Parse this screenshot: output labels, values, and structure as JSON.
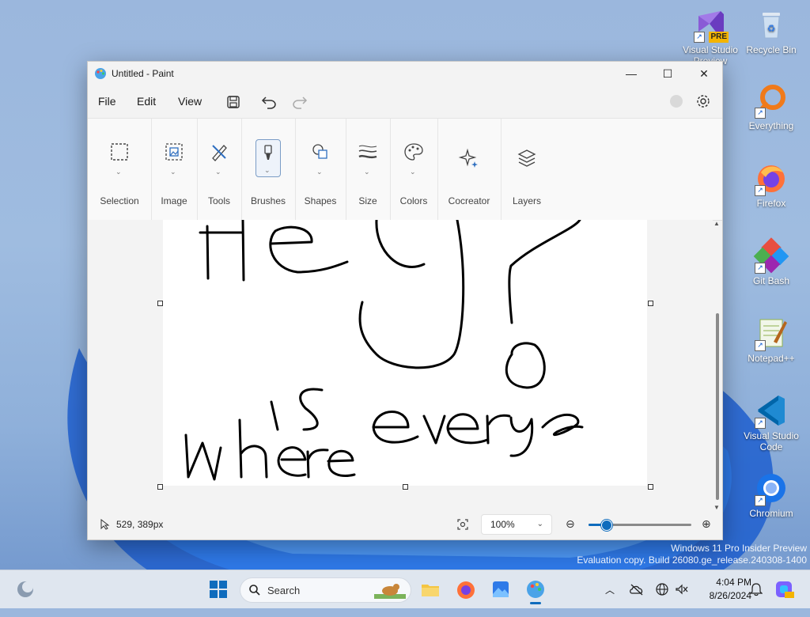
{
  "window": {
    "title": "Untitled - Paint",
    "minimize": "—",
    "maximize": "☐",
    "close": "✕"
  },
  "menu": {
    "file": "File",
    "edit": "Edit",
    "view": "View"
  },
  "ribbon": {
    "groups": [
      {
        "label": "Selection",
        "icon": "selection-icon"
      },
      {
        "label": "Image",
        "icon": "image-icon"
      },
      {
        "label": "Tools",
        "icon": "tools-icon"
      },
      {
        "label": "Brushes",
        "icon": "brush-icon"
      },
      {
        "label": "Shapes",
        "icon": "shapes-icon"
      },
      {
        "label": "Size",
        "icon": "size-icon"
      },
      {
        "label": "Colors",
        "icon": "palette-icon"
      },
      {
        "label": "Cocreator",
        "icon": "sparkle-icon"
      },
      {
        "label": "Layers",
        "icon": "layers-icon"
      }
    ]
  },
  "status": {
    "coords": "529, 389px",
    "zoom": "100%"
  },
  "desktop": {
    "icons": [
      {
        "label": "Visual Studio Preview"
      },
      {
        "label": "Recycle Bin"
      },
      {
        "label": "Everything"
      },
      {
        "label": "Firefox"
      },
      {
        "label": "Git Bash"
      },
      {
        "label": "Notepad++"
      },
      {
        "label": "Visual Studio Code"
      },
      {
        "label": "Chromium"
      }
    ],
    "vs_badge": "PRE"
  },
  "watermark": {
    "line1": "Windows 11 Pro Insider Preview",
    "line2": "Evaluation copy. Build 26080.ge_release.240308-1400"
  },
  "taskbar": {
    "search": "Search",
    "time": "4:04 PM",
    "date": "8/26/2024"
  },
  "colors": {
    "accent": "#0f6cbd"
  }
}
